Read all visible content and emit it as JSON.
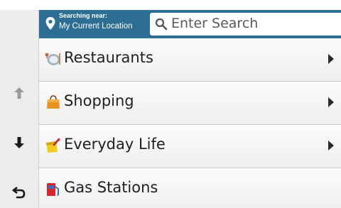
{
  "header": {
    "near_label": "Searching near:",
    "near_value": "My Current Location",
    "search_placeholder": "Enter Search",
    "accent_color": "#2d6e94"
  },
  "rail": {
    "buttons": [
      {
        "icon": "arrow-up-icon"
      },
      {
        "icon": "arrow-down-icon"
      },
      {
        "icon": "back-icon"
      }
    ]
  },
  "categories": [
    {
      "label": "Restaurants",
      "icon": "restaurant-plate-icon",
      "has_arrow": true
    },
    {
      "label": "Shopping",
      "icon": "shopping-bag-icon",
      "has_arrow": true
    },
    {
      "label": "Everyday Life",
      "icon": "everyday-life-icon",
      "has_arrow": true
    },
    {
      "label": "Gas Stations",
      "icon": "gas-pump-icon",
      "has_arrow": false
    }
  ]
}
